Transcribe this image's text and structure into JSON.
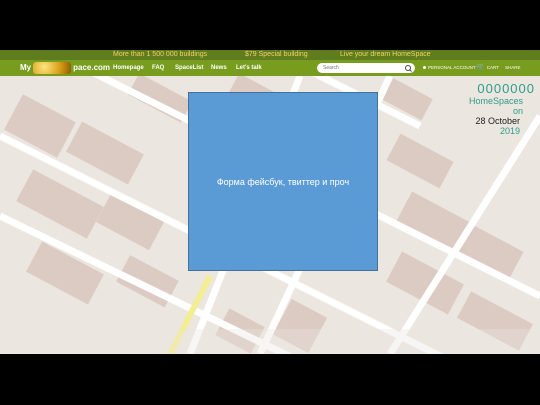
{
  "banner": {
    "items": [
      "More than 1 500 000 buildings",
      "$79 Special building",
      "Live your dream HomeSpace"
    ]
  },
  "navbar": {
    "logo_left": "My",
    "logo_right": "pace.com",
    "items": [
      "Homepage",
      "FAQ",
      "SpaceList",
      "News",
      "Let's talk"
    ],
    "search_placeholder": "Search",
    "account_label": "PERSONAL ACCOUNT",
    "cart_label": "CART",
    "share_label": "SHARE"
  },
  "counter": {
    "value": "0000000",
    "label": "HomeSpaces",
    "on": "on",
    "date": "28 October",
    "year": "2019"
  },
  "overlay": {
    "text": "Форма фейсбук, твиттер и проч"
  },
  "colors": {
    "banner": "#5f7d1e",
    "navbar": "#789c1d",
    "map_bg": "#ebe6df",
    "overlay": "#5b9bd5",
    "counter": "#2e9c8a"
  }
}
